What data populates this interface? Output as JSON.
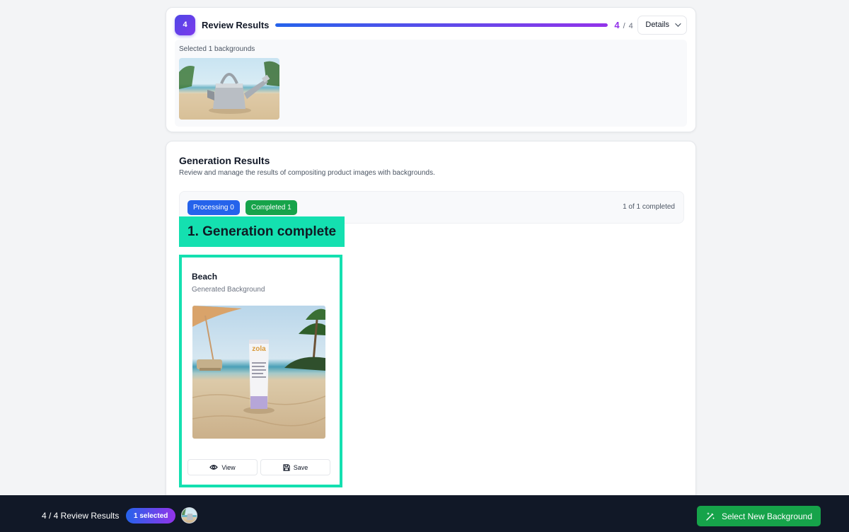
{
  "step": {
    "number": "4",
    "title": "Review Results",
    "progress": 1.0,
    "current": "4",
    "separator": "/",
    "total": "4",
    "details_label": "Details",
    "selected_text": "Selected 1 backgrounds"
  },
  "results": {
    "title": "Generation Results",
    "description": "Review and manage the results of compositing product images with backgrounds.",
    "processing_label": "Processing 0",
    "completed_label": "Completed 1",
    "completed_summary": "1 of 1 completed",
    "annotation": "1. Generation complete",
    "items": [
      {
        "name": "Beach",
        "subtitle": "Generated Background",
        "view_label": "View",
        "save_label": "Save",
        "product_text": "zola"
      }
    ]
  },
  "bottom_bar": {
    "step_label": "4 / 4 Review Results",
    "selected_label": "1 selected",
    "cta_label": "Select New Background"
  },
  "colors": {
    "accent_gradient_start": "#2563eb",
    "accent_gradient_end": "#9333ea",
    "processing": "#2563eb",
    "completed": "#16a34a",
    "annotation": "#14e0b0",
    "bottom_bar": "#111827"
  }
}
